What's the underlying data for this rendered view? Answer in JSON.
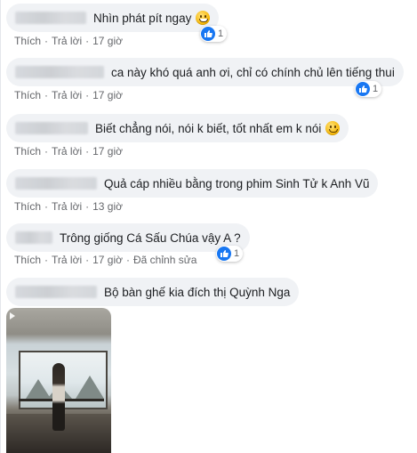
{
  "actions": {
    "like": "Thích",
    "reply": "Trả lời",
    "separator": "·",
    "edited": "Đã chỉnh sửa"
  },
  "comments": [
    {
      "text": "Nhìn phát pít ngay",
      "emoji": "grinning-face",
      "time": "17 giờ",
      "reactions": "1"
    },
    {
      "text": "ca này khó quá anh ơi, chỉ có chính chủ lên tiếng thui",
      "time": "17 giờ",
      "reactions": "1"
    },
    {
      "text": "Biết chẳng nói, nói k biết, tốt nhất em k nói",
      "emoji": "smiling-face",
      "time": "17 giờ"
    },
    {
      "text": "Quả cáp nhiều bằng trong phim Sinh Tử k Anh Vũ",
      "time": "13 giờ"
    },
    {
      "text": "Trông giống Cá Sấu Chúa vậy A ?",
      "time": "17 giờ",
      "reactions": "1",
      "edited": true
    },
    {
      "text": "Bộ bàn ghế kia đích thị Quỳnh Nga"
    }
  ],
  "colors": {
    "bubble": "#f0f2f5",
    "like_blue": "#1877f2",
    "meta_text": "#65676b"
  }
}
